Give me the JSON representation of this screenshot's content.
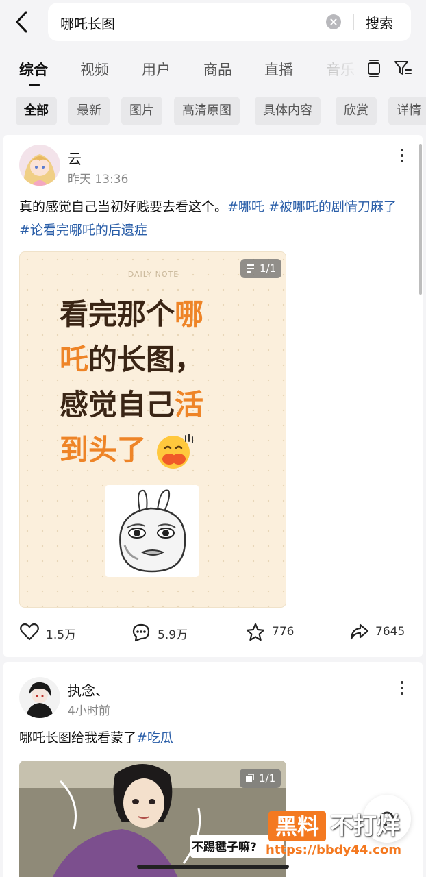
{
  "header": {
    "search_query": "哪吒长图",
    "search_button": "搜索"
  },
  "tabs": [
    {
      "label": "综合",
      "active": true
    },
    {
      "label": "视频"
    },
    {
      "label": "用户"
    },
    {
      "label": "商品"
    },
    {
      "label": "直播"
    },
    {
      "label": "音乐"
    }
  ],
  "filter_chips": [
    "全部",
    "最新",
    "图片",
    "高清原图",
    "具体内容",
    "欣赏",
    "详情"
  ],
  "posts": [
    {
      "username": "云",
      "time": "昨天 13:36",
      "text": "真的感觉自己当初好贱要去看这个。",
      "tags": [
        "#哪吒",
        "#被哪吒的剧情刀麻了",
        "#论看完哪吒的后遗症"
      ],
      "image": {
        "header": "DAILY NOTE",
        "count": "1/1",
        "lines": [
          {
            "dark": "看完那个",
            "orange": "哪"
          },
          {
            "orange": "吒",
            "dark": "的长图，"
          },
          {
            "dark": "感觉自己",
            "orange": "活"
          },
          {
            "orange": "到头了"
          }
        ]
      },
      "stats": {
        "likes": "1.5万",
        "comments": "5.9万",
        "favorites": "776",
        "shares": "7645"
      }
    },
    {
      "username": "执念、",
      "time": "4小时前",
      "text": "哪吒长图给我看蒙了",
      "tags": [
        "#吃瓜"
      ],
      "image": {
        "count": "1/1",
        "caption": "不踢毽子嘛?"
      }
    }
  ],
  "watermark": {
    "box": "黑料",
    "text": "不打烊",
    "url": "https://bbdy44.com"
  },
  "colors": {
    "accent_orange": "#ee8427",
    "tag_blue": "#2a5ea8",
    "brand_orange": "#f47920"
  }
}
